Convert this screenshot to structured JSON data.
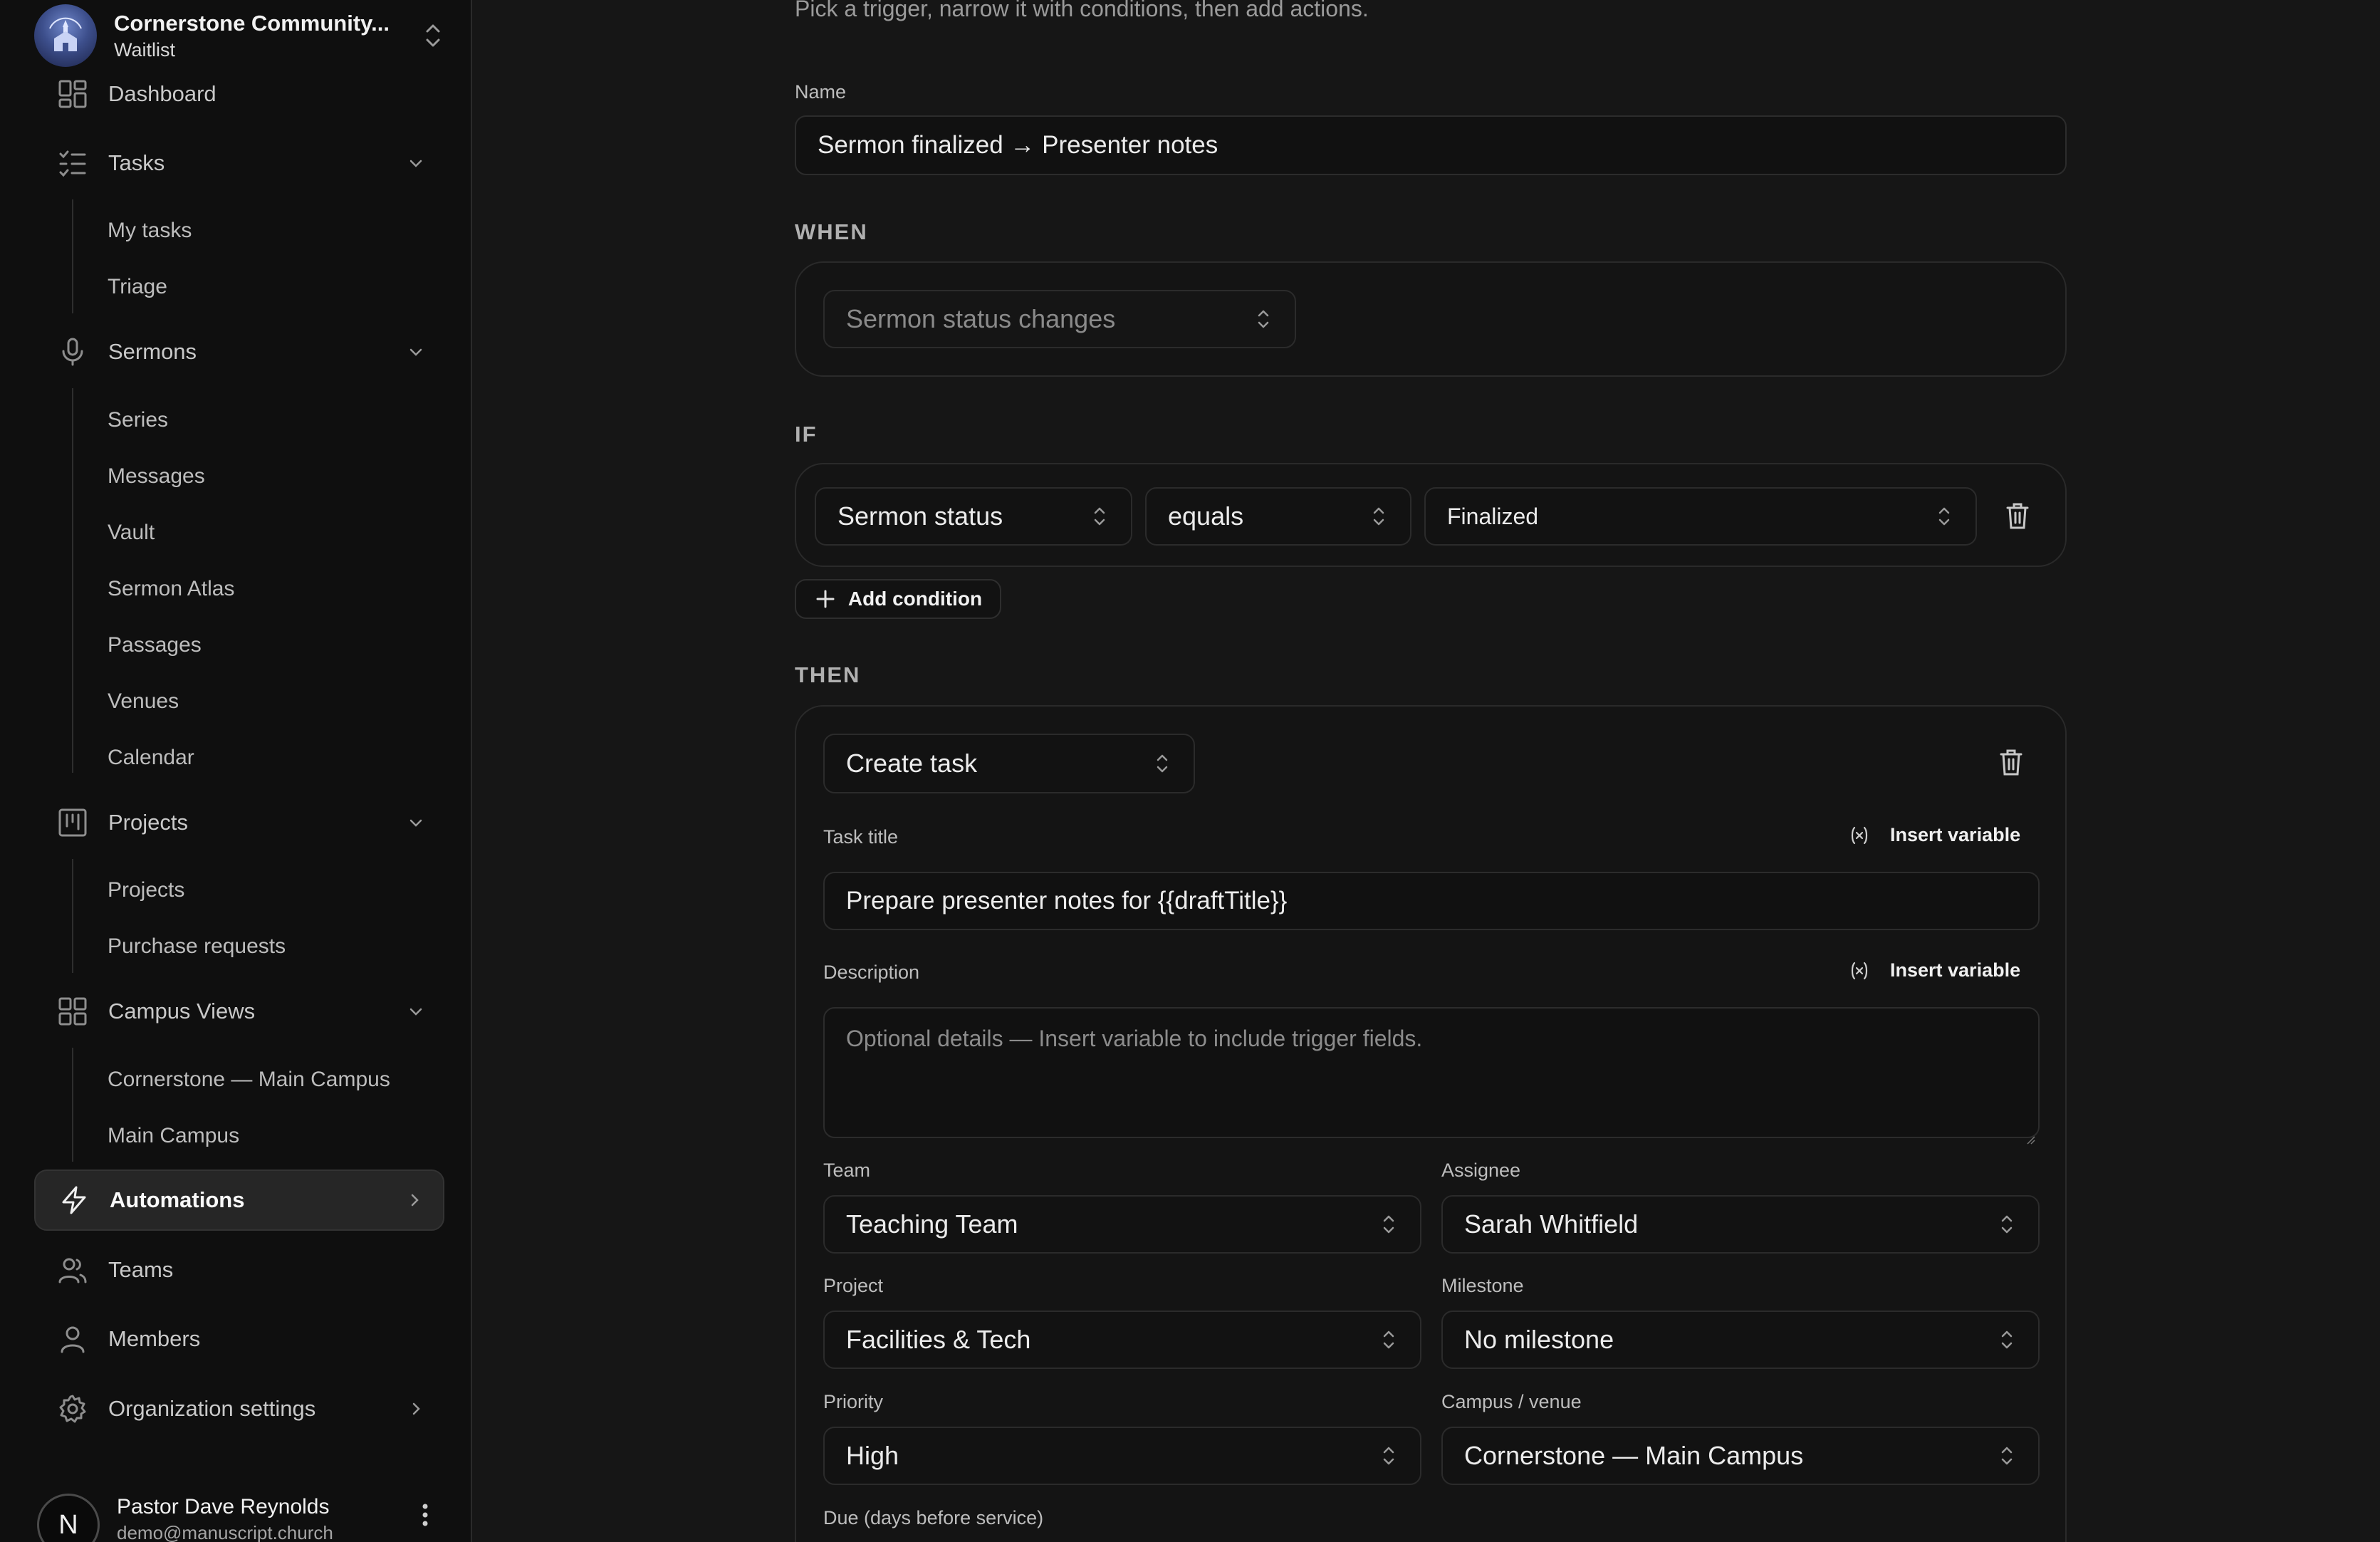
{
  "org": {
    "name": "Cornerstone Community...",
    "subtitle": "Waitlist"
  },
  "nav": {
    "dashboard": "Dashboard",
    "tasks": "Tasks",
    "tasks_sub": [
      "My tasks",
      "Triage"
    ],
    "sermons": "Sermons",
    "sermons_sub": [
      "Series",
      "Messages",
      "Vault",
      "Sermon Atlas",
      "Passages",
      "Venues",
      "Calendar"
    ],
    "projects": "Projects",
    "projects_sub": [
      "Projects",
      "Purchase requests"
    ],
    "campus_views": "Campus Views",
    "campus_sub": [
      "Cornerstone — Main Campus",
      "Main Campus"
    ],
    "automations": "Automations",
    "teams": "Teams",
    "members": "Members",
    "org_settings": "Organization settings"
  },
  "user": {
    "initial": "N",
    "name": "Pastor Dave Reynolds",
    "email": "demo@manuscript.church"
  },
  "form": {
    "subtitle": "Pick a trigger, narrow it with conditions, then add actions.",
    "name_label": "Name",
    "name_value": "Sermon finalized → Presenter notes",
    "when_label": "WHEN",
    "trigger_value": "Sermon status changes",
    "if_label": "IF",
    "condition": {
      "field": "Sermon status",
      "operator": "equals",
      "value": "Finalized"
    },
    "add_condition": "Add condition",
    "then_label": "THEN",
    "action_type": "Create task",
    "task_title_label": "Task title",
    "insert_variable": "Insert variable",
    "task_title_value": "Prepare presenter notes for {{draftTitle}}",
    "description_label": "Description",
    "description_placeholder": "Optional details — Insert variable to include trigger fields.",
    "team_label": "Team",
    "team_value": "Teaching Team",
    "assignee_label": "Assignee",
    "assignee_value": "Sarah Whitfield",
    "project_label": "Project",
    "project_value": "Facilities & Tech",
    "milestone_label": "Milestone",
    "milestone_value": "No milestone",
    "priority_label": "Priority",
    "priority_value": "High",
    "campus_label": "Campus / venue",
    "campus_value": "Cornerstone — Main Campus",
    "due_label": "Due (days before service)"
  },
  "icons": {
    "dashboard": "grid-icon",
    "tasks": "list-check-icon",
    "sermons": "microphone-icon",
    "projects": "kanban-icon",
    "campus": "grid-icon",
    "automations": "bolt-icon",
    "teams": "users-icon",
    "members": "user-icon",
    "settings": "gear-icon"
  }
}
